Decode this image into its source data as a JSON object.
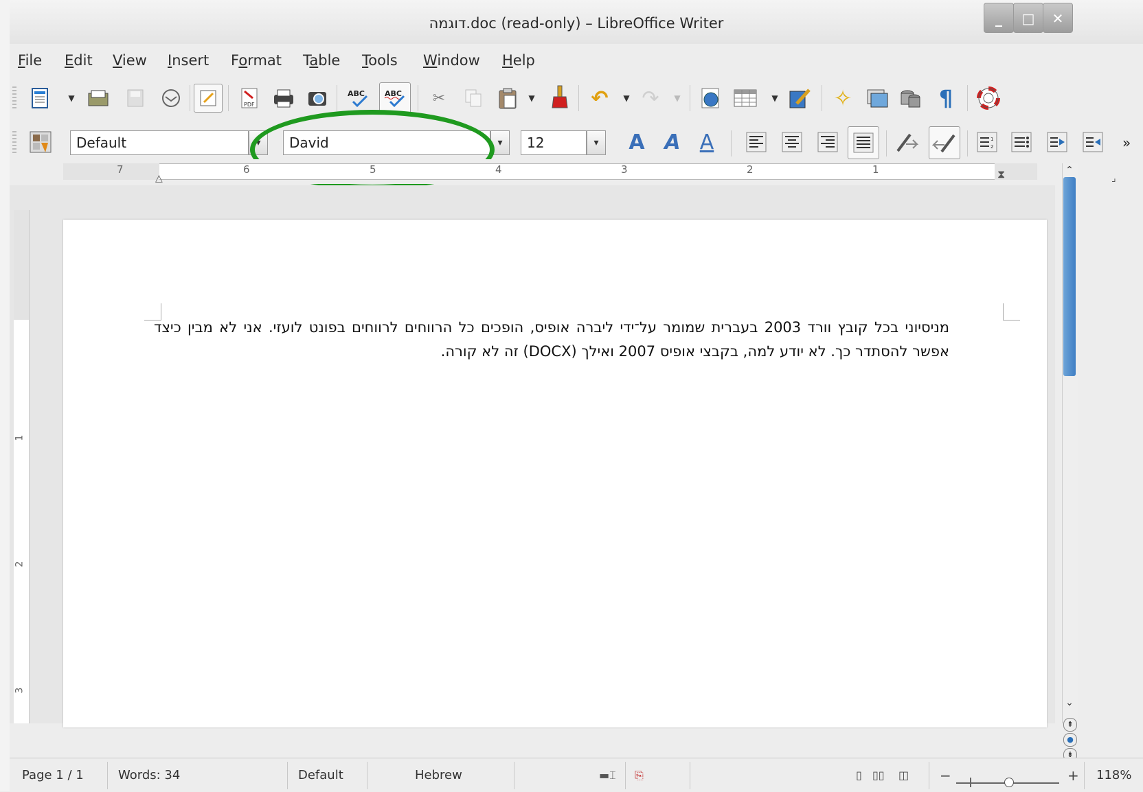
{
  "window": {
    "title": "דוגמה.doc (read-only) – LibreOffice Writer",
    "minimize": "_",
    "maximize": "□",
    "close": "✕"
  },
  "menubar": {
    "items": [
      {
        "pre": "",
        "u": "F",
        "post": "ile"
      },
      {
        "pre": "",
        "u": "E",
        "post": "dit"
      },
      {
        "pre": "",
        "u": "V",
        "post": "iew"
      },
      {
        "pre": "",
        "u": "I",
        "post": "nsert"
      },
      {
        "pre": "F",
        "u": "o",
        "post": "rmat"
      },
      {
        "pre": "T",
        "u": "a",
        "post": "ble"
      },
      {
        "pre": "",
        "u": "T",
        "post": "ools"
      },
      {
        "pre": "",
        "u": "W",
        "post": "indow"
      },
      {
        "pre": "",
        "u": "H",
        "post": "elp"
      }
    ]
  },
  "formatting": {
    "paragraph_style": "Default",
    "font_name": "David",
    "font_size": "12",
    "more": "»"
  },
  "ruler": {
    "numbers": [
      "7",
      "6",
      "5",
      "4",
      "3",
      "2",
      "1"
    ]
  },
  "vruler": {
    "numbers": [
      "1",
      "2",
      "3"
    ]
  },
  "document": {
    "text": "מניסיוני בכל קובץ וורד 2003 בעברית שמומר על־ידי ליברה אופיס, הופכים כל הרווחים לרווחים בפונט לועזי. אני לא מבין כיצד אפשר להסתדר כך. לא יודע למה, בקבצי אופיס 2007 ואילך (DOCX) זה לא קורה."
  },
  "status": {
    "page": "Page 1 / 1",
    "words": "Words: 34",
    "style": "Default",
    "language": "Hebrew",
    "zoom": "118%"
  },
  "colors": {
    "annotation_ellipse": "#1f9a1f",
    "scroll_thumb": "#3f7fc4"
  }
}
